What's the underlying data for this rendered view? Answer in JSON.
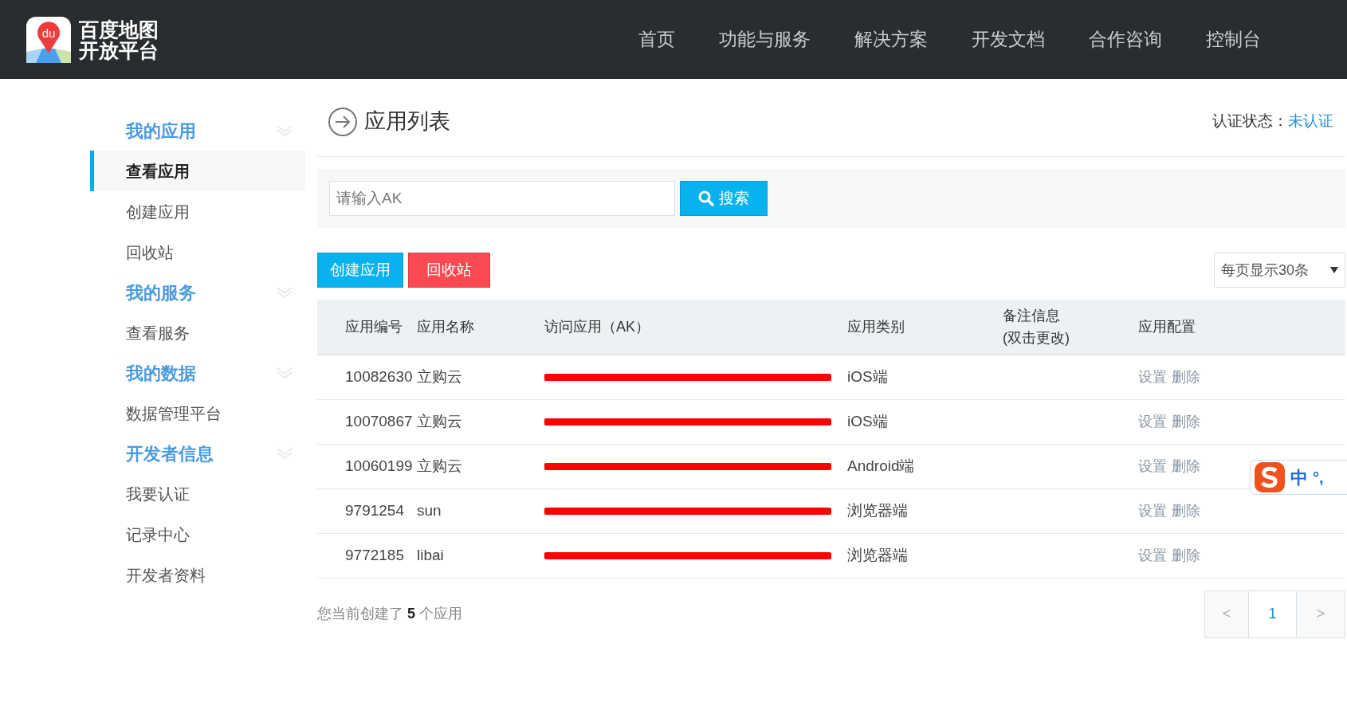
{
  "header": {
    "logo_mark": "du",
    "logo_text": [
      "百度地图",
      "开放平台"
    ],
    "nav": [
      {
        "label": "首页"
      },
      {
        "label": "功能与服务"
      },
      {
        "label": "解决方案"
      },
      {
        "label": "开发文档"
      },
      {
        "label": "合作咨询"
      },
      {
        "label": "控制台"
      }
    ]
  },
  "sidebar": {
    "groups": [
      {
        "title": "我的应用",
        "items": [
          {
            "label": "查看应用",
            "selected": true
          },
          {
            "label": "创建应用",
            "selected": false
          },
          {
            "label": "回收站",
            "selected": false
          }
        ]
      },
      {
        "title": "我的服务",
        "items": [
          {
            "label": "查看服务",
            "selected": false
          }
        ]
      },
      {
        "title": "我的数据",
        "items": [
          {
            "label": "数据管理平台",
            "selected": false
          }
        ]
      },
      {
        "title": "开发者信息",
        "items": [
          {
            "label": "我要认证",
            "selected": false
          },
          {
            "label": "记录中心",
            "selected": false
          },
          {
            "label": "开发者资料",
            "selected": false
          }
        ]
      }
    ]
  },
  "page_title": "应用列表",
  "auth_status": {
    "label": "认证状态：",
    "value": "未认证"
  },
  "search": {
    "placeholder": "请输入AK",
    "button": "搜索"
  },
  "actions": [
    {
      "label": "创建应用",
      "kind": "primary"
    },
    {
      "label": "回收站",
      "kind": "danger"
    }
  ],
  "page_size": "每页显示30条",
  "table": {
    "columns": [
      "应用编号",
      "应用名称",
      "访问应用（AK）",
      "应用类别",
      "备注信息\n(双击更改)",
      "应用配置"
    ],
    "rows": [
      {
        "id": "10082630",
        "name": "立购云",
        "type": "iOS端",
        "actions": [
          "设置",
          "删除"
        ]
      },
      {
        "id": "10070867",
        "name": "立购云",
        "type": "iOS端",
        "actions": [
          "设置",
          "删除"
        ]
      },
      {
        "id": "10060199",
        "name": "立购云",
        "type": "Android端",
        "actions": [
          "设置",
          "删除"
        ]
      },
      {
        "id": "9791254",
        "name": "sun",
        "type": "浏览器端",
        "actions": [
          "设置",
          "删除"
        ]
      },
      {
        "id": "9772185",
        "name": "libai",
        "type": "浏览器端",
        "actions": [
          "设置",
          "删除"
        ]
      }
    ]
  },
  "summary": "您当前创建了 **5** 个应用",
  "pagination": {
    "prev": "<",
    "pages": [
      {
        "label": "1",
        "selected": true
      }
    ],
    "next": ">"
  },
  "ime_toolbar": {
    "mode": "中",
    "punct": "°,"
  }
}
